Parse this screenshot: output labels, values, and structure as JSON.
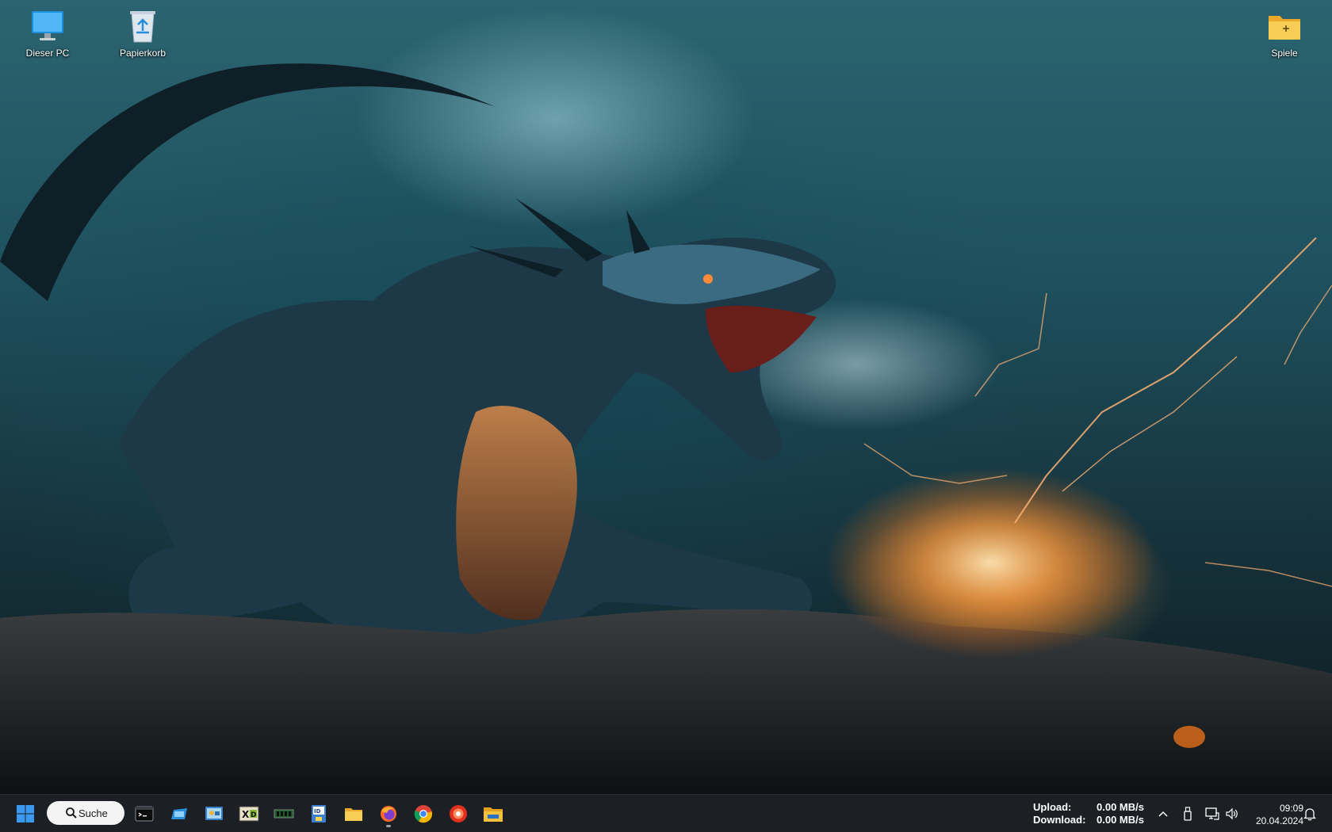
{
  "desktop": {
    "icons": [
      {
        "label": "Dieser PC",
        "icon": "this-pc-monitor-icon"
      },
      {
        "label": "Papierkorb",
        "icon": "recycle-bin-icon"
      },
      {
        "label": "Spiele",
        "icon": "folder-icon"
      }
    ],
    "wallpaper": "dragon-lightning-storm"
  },
  "taskbar": {
    "search": {
      "label": "Suche",
      "icon": "search-icon"
    },
    "apps": [
      "start-windows-icon",
      "terminal-icon",
      "window-app-icon",
      "control-panel-icon",
      "xd-app-icon",
      "memory-chip-icon",
      "id-card-app-icon",
      "file-explorer-folder-icon",
      "firefox-icon",
      "chrome-icon",
      "red-app-icon",
      "folder-app-icon"
    ],
    "network_speed": {
      "upload_label": "Upload:",
      "upload_value": "0.00 MB/s",
      "download_label": "Download:",
      "download_value": "0.00 MB/s"
    },
    "tray": {
      "icons": [
        "chevron-up-icon",
        "usb-device-icon",
        "network-icon",
        "volume-icon",
        "notification-bell-icon"
      ]
    },
    "clock": {
      "time": "09:09",
      "date": "20.04.2024"
    }
  },
  "colors": {
    "taskbar_bg": "#1c1f24",
    "windows_blue": "#3b9af0",
    "folder_yellow": "#f5c84a"
  }
}
